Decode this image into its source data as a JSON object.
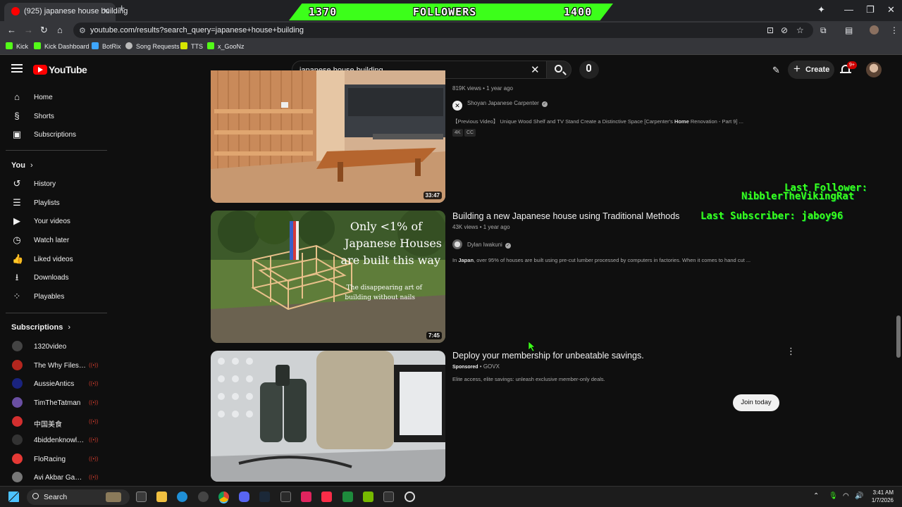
{
  "browser": {
    "tab_title": "(925) japanese house building",
    "url": "youtube.com/results?search_query=japanese+house+building",
    "bookmarks": [
      "Kick",
      "Kick Dashboard",
      "BotRix",
      "Song Requests",
      "TTS",
      "x_GooNz"
    ]
  },
  "stream_overlay": {
    "followers_current": "1370",
    "followers_label": "FOLLOWERS",
    "followers_goal": "1400",
    "last_follower": "Last Follower: NibblerTheVikingRat",
    "last_follower_label": "Last Follower:",
    "last_follower_name": "NibblerTheVikingRat",
    "last_subscriber": "Last Subscriber: jaboy96"
  },
  "youtube": {
    "logo_text": "YouTube",
    "search_query": "japanese house building",
    "create_label": "Create",
    "notifications_badge": "9+"
  },
  "sidebar": {
    "main": [
      {
        "label": "Home",
        "icon": "home-icon"
      },
      {
        "label": "Shorts",
        "icon": "shorts-icon"
      },
      {
        "label": "Subscriptions",
        "icon": "subscriptions-icon"
      }
    ],
    "you_heading": "You",
    "you": [
      {
        "label": "History"
      },
      {
        "label": "Playlists"
      },
      {
        "label": "Your videos"
      },
      {
        "label": "Watch later"
      },
      {
        "label": "Liked videos"
      },
      {
        "label": "Downloads"
      },
      {
        "label": "Playables"
      }
    ],
    "subscriptions_heading": "Subscriptions",
    "subscriptions": [
      {
        "label": "1320video",
        "color": "#444444",
        "live": false
      },
      {
        "label": "The Why Files - B...",
        "color": "#b3261e",
        "live": true
      },
      {
        "label": "AussieAntics",
        "color": "#1a237e",
        "live": true
      },
      {
        "label": "TimTheTatman",
        "color": "#6a4fa3",
        "live": true
      },
      {
        "label": "中国美食",
        "color": "#d32f2f",
        "live": true
      },
      {
        "label": "4biddenknowled...",
        "color": "#333333",
        "live": true
      },
      {
        "label": "FloRacing",
        "color": "#e53935",
        "live": true
      },
      {
        "label": "Avi Akbar Gaming",
        "color": "#777777",
        "live": true
      }
    ]
  },
  "results": [
    {
      "views": "819K views",
      "age": "1 year ago",
      "channel": "Shoyan Japanese Carpenter",
      "description_pre": "【Previous Video】 Unique Wood Shelf and TV Stand Create a Distinctive Space [Carpenter's ",
      "description_bold": "Home",
      "description_post": " Renovation - Part 9] ...",
      "tags": [
        "4K",
        "CC"
      ],
      "duration": "33:47"
    },
    {
      "title": "Building a new Japanese house using Traditional Methods",
      "views": "43K views",
      "age": "1 year ago",
      "channel": "Dylan Iwakuni",
      "description_pre": "In ",
      "description_bold": "Japan",
      "description_post": ", over 95% of houses are built using pre-cut lumber processed by computers in factories. When it comes to hand cut ...",
      "duration": "7:45",
      "thumb_text_1": "Only <1% of",
      "thumb_text_2": "Japanese Houses",
      "thumb_text_3": "are built this way",
      "thumb_text_4": "The disappearing art of",
      "thumb_text_5": "building without nails"
    },
    {
      "title": "Deploy your membership for unbeatable savings.",
      "sponsored": "Sponsored",
      "advertiser": "GOVX",
      "description": "Elite access, elite savings: unleash exclusive member-only deals.",
      "cta": "Join today"
    }
  ],
  "taskbar": {
    "search_label": "Search",
    "time": "3:41 AM",
    "date": "1/7/2026"
  }
}
